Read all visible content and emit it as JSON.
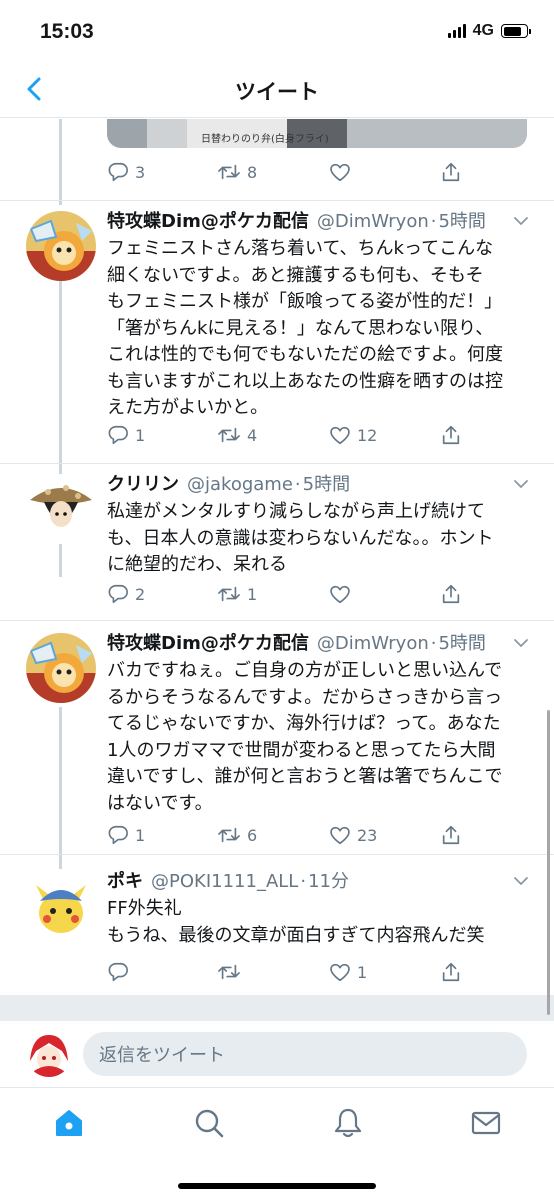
{
  "status_bar": {
    "time": "15:03",
    "network": "4G"
  },
  "header": {
    "title": "ツイート"
  },
  "media": {
    "label": "日替わりのり弁(白身フライ)"
  },
  "prev_tweet": {
    "reply_count": "3",
    "retweet_count": "8",
    "like_count": ""
  },
  "tweets": [
    {
      "name": "特攻蝶Dim@ポケカ配信",
      "handle": "@DimWryon",
      "time": "5時間",
      "text": "フェミニストさん落ち着いて、ちんkってこんな\n細くないですよ。あと擁護するも何も、そもそ\nもフェミニスト様が「飯喰ってる姿が性的だ！」\n「箸がちんkに見える！」なんて思わない限り、\nこれは性的でも何でもないただの絵ですよ。何度\nも言いますがこれ以上あなたの性癖を晒すのは控\nえた方がよいかと。",
      "reply_count": "1",
      "retweet_count": "4",
      "like_count": "12"
    },
    {
      "name": "クリリン",
      "handle": "@jakogame",
      "time": "5時間",
      "text": "私達がメンタルすり減らしながら声上げ続けて\nも、日本人の意識は変わらないんだな。。ホント\nに絶望的だわ、呆れる",
      "reply_count": "2",
      "retweet_count": "1",
      "like_count": ""
    },
    {
      "name": "特攻蝶Dim@ポケカ配信",
      "handle": "@DimWryon",
      "time": "5時間",
      "text": "バカですねぇ。ご自身の方が正しいと思い込んで\nるからそうなるんですよ。だからさっきから言っ\nてるじゃないですか、海外行けば？って。あなた\n1人のワガママで世間が変わると思ってたら大間\n違いですし、誰が何と言おうと箸は箸でちんこで\nはないです。",
      "reply_count": "1",
      "retweet_count": "6",
      "like_count": "23"
    },
    {
      "name": "ポキ",
      "handle": "@POKI1111_ALL",
      "time": "11分",
      "text": "FF外失礼\nもうね、最後の文章が面白すぎて内容飛んだ笑",
      "reply_count": "",
      "retweet_count": "",
      "like_count": "1"
    }
  ],
  "reply_bar": {
    "placeholder": "返信をツイート"
  },
  "tabs": [
    "home-icon",
    "search-icon",
    "notifications-icon",
    "messages-icon"
  ],
  "colors": {
    "accent": "#1da1f2",
    "muted": "#657786",
    "divider": "#e1e8ed"
  }
}
